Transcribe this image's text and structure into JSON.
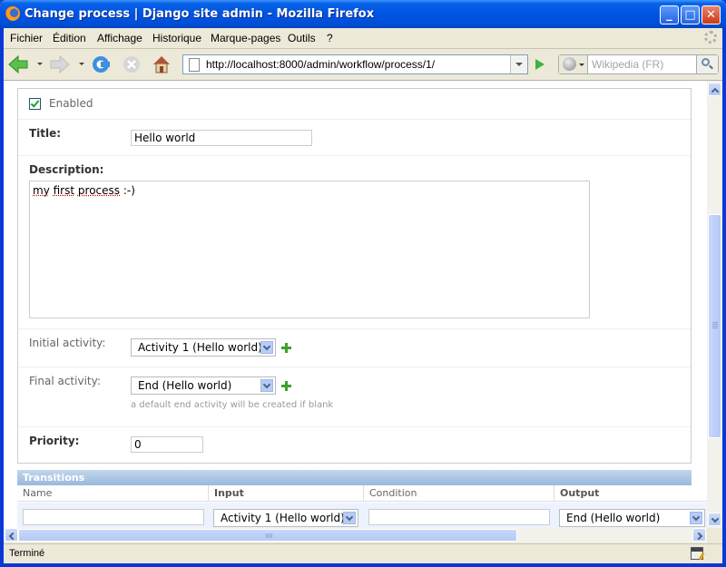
{
  "window": {
    "title": "Change process | Django site admin - Mozilla Firefox",
    "controls": {
      "minimize": "_",
      "maximize": "□",
      "close": "✕"
    }
  },
  "menubar": {
    "items": [
      {
        "label": "Fichier"
      },
      {
        "label": "Édition"
      },
      {
        "label": "Affichage"
      },
      {
        "label": "Historique"
      },
      {
        "label": "Marque-pages"
      },
      {
        "label": "Outils"
      },
      {
        "label": "?"
      }
    ]
  },
  "navbar": {
    "url": "http://localhost:8000/admin/workflow/process/1/",
    "search_placeholder": "Wikipedia (FR)",
    "icons": [
      "back-icon",
      "forward-icon",
      "reload-icon",
      "stop-icon",
      "home-icon",
      "go-icon",
      "search-icon"
    ]
  },
  "form": {
    "enabled": {
      "label": "Enabled",
      "checked": true
    },
    "title": {
      "label": "Title:",
      "value": "Hello world"
    },
    "description": {
      "label": "Description:",
      "value_words": [
        "my",
        "first",
        "process"
      ],
      "value_rest": ":-)"
    },
    "initial_activity": {
      "label": "Initial activity:",
      "value": "Activity 1 (Hello world)"
    },
    "final_activity": {
      "label": "Final activity:",
      "value": "End (Hello world)",
      "help": "a default end activity will be created if blank"
    },
    "priority": {
      "label": "Priority:",
      "value": "0"
    }
  },
  "transitions": {
    "title": "Transitions",
    "columns": [
      "Name",
      "Input",
      "Condition",
      "Output"
    ],
    "rows": [
      {
        "name": "",
        "input": "Activity 1 (Hello world)",
        "condition": "",
        "output": "End (Hello world)"
      }
    ]
  },
  "status": {
    "text": "Terminé"
  },
  "colors": {
    "titlebar": "#0054e3",
    "transitions_header": "#98b9dc",
    "add_icon": "#3f9f2f",
    "required_label": "#333333"
  }
}
